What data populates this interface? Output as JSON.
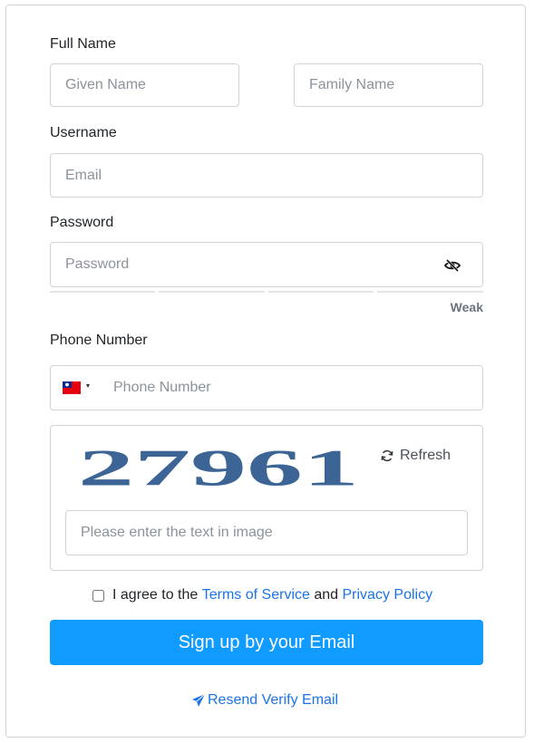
{
  "form": {
    "full_name": {
      "label": "Full Name",
      "given_placeholder": "Given Name",
      "family_placeholder": "Family Name"
    },
    "username": {
      "label": "Username",
      "placeholder": "Email"
    },
    "password": {
      "label": "Password",
      "placeholder": "Password",
      "strength": "Weak",
      "toggle_icon": "eye-slash-icon"
    },
    "phone": {
      "label": "Phone Number",
      "placeholder": "Phone Number",
      "country_flag": "taiwan-flag-icon"
    },
    "captcha": {
      "image_text": "27961",
      "refresh_label": "Refresh",
      "placeholder": "Please enter the text in image"
    },
    "agree": {
      "prefix": "I agree to the",
      "terms": "Terms of Service",
      "and": "and",
      "privacy": "Privacy Policy"
    },
    "signup_label": "Sign up by your Email",
    "resend_label": "Resend Verify Email"
  },
  "colors": {
    "primary_button": "#0f9bff",
    "link": "#1a73e8",
    "captcha_text": "#3c6595"
  }
}
